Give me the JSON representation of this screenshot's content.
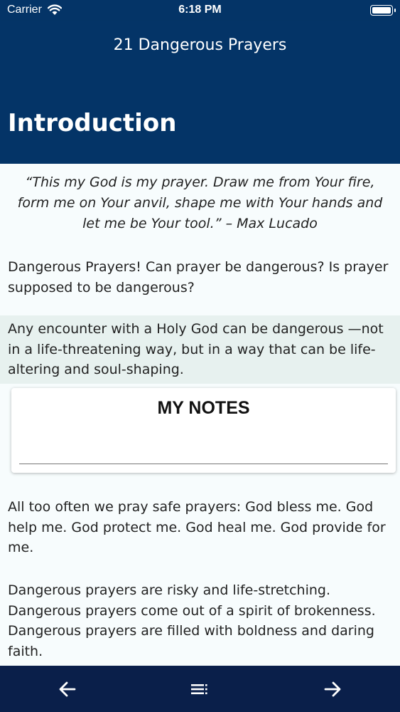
{
  "status_bar": {
    "carrier": "Carrier",
    "time": "6:18 PM",
    "icons": [
      "wifi-icon",
      "battery-icon"
    ]
  },
  "nav_bar": {
    "title": "21 Dangerous Prayers"
  },
  "page": {
    "title": "Introduction"
  },
  "content": {
    "quote": "“This my God is my prayer. Draw me from Your fire, form me on Your anvil, shape me with Your hands and let me be Your tool.” – Max Lucado",
    "paragraphs": [
      "Dangerous Prayers! Can prayer be dangerous? Is prayer supposed to be dangerous?",
      "Any encounter with a Holy God can be dangerous —not in a life-threatening way, but in a way that can be life-altering and soul-shaping.",
      "All too often we pray safe prayers: God bless me. God help me. God protect me. God heal me. God provide for me.",
      "Dangerous prayers are risky and life-stretching. Dangerous prayers come out of a spirit of brokenness. Dangerous prayers are filled with boldness and daring faith."
    ]
  },
  "notes": {
    "title": "MY NOTES",
    "value": ""
  },
  "tab_bar": {
    "buttons": [
      "back-arrow-icon",
      "menu-icon",
      "forward-arrow-icon"
    ]
  },
  "colors": {
    "header_bg": "#043467",
    "tab_bar_bg": "#0a1f4a",
    "highlight_bg": "#e7f1ef",
    "content_bg": "#f7fcfd"
  }
}
